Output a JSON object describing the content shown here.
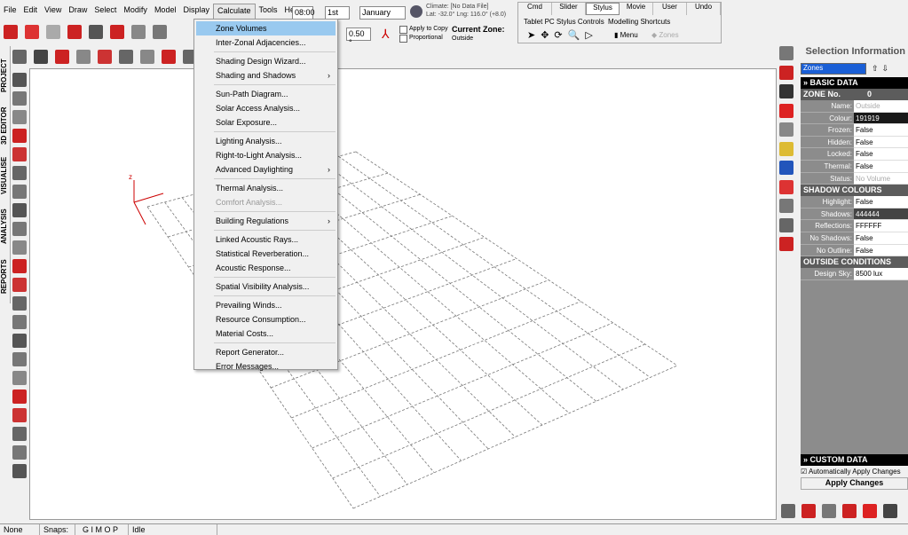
{
  "menubar": [
    "File",
    "Edit",
    "View",
    "Draw",
    "Select",
    "Modify",
    "Model",
    "Display",
    "Calculate",
    "Tools",
    "Help"
  ],
  "toolbar": {
    "time": "08:00",
    "day": "1st",
    "month": "January",
    "climate": "Climate: [No Data File]",
    "latlng": "Lat: -32.0°   Lng: 116.0° (+8.0)",
    "angle": "0.50 °",
    "apply_to_copy": "Apply to Copy",
    "proportional": "Proportional",
    "current_zone_label": "Current Zone:",
    "current_zone": "Outside"
  },
  "tabs": [
    "Cmd",
    "Slider",
    "Stylus",
    "Movie",
    "User",
    "Undo"
  ],
  "stylus": {
    "tablet_label": "Tablet PC Stylus Controls",
    "shortcuts_label": "Modelling Shortcuts",
    "menu": "Menu",
    "zones": "Zones"
  },
  "side_tabs": [
    "PROJECT",
    "3D EDITOR",
    "VISUALISE",
    "ANALYSIS",
    "REPORTS"
  ],
  "calc_menu": [
    {
      "label": "Zone Volumes",
      "state": "highlighted"
    },
    {
      "label": "Inter-Zonal Adjacencies..."
    },
    {
      "sep": true
    },
    {
      "label": "Shading Design Wizard..."
    },
    {
      "label": "Shading and Shadows",
      "sub": true
    },
    {
      "sep": true
    },
    {
      "label": "Sun-Path Diagram..."
    },
    {
      "label": "Solar Access Analysis..."
    },
    {
      "label": "Solar Exposure..."
    },
    {
      "sep": true
    },
    {
      "label": "Lighting Analysis..."
    },
    {
      "label": "Right-to-Light Analysis..."
    },
    {
      "label": "Advanced Daylighting",
      "sub": true
    },
    {
      "sep": true
    },
    {
      "label": "Thermal Analysis..."
    },
    {
      "label": "Comfort Analysis...",
      "state": "disabled"
    },
    {
      "sep": true
    },
    {
      "label": "Building Regulations",
      "sub": true
    },
    {
      "sep": true
    },
    {
      "label": "Linked Acoustic Rays..."
    },
    {
      "label": "Statistical Reverberation..."
    },
    {
      "label": "Acoustic Response..."
    },
    {
      "sep": true
    },
    {
      "label": "Spatial Visibility Analysis..."
    },
    {
      "sep": true
    },
    {
      "label": "Prevailing Winds..."
    },
    {
      "label": "Resource Consumption..."
    },
    {
      "label": "Material Costs..."
    },
    {
      "sep": true
    },
    {
      "label": "Report Generator..."
    },
    {
      "label": "Error Messages..."
    }
  ],
  "panel": {
    "title": "Selection Information",
    "selector": "Zones",
    "basic_data": "BASIC DATA",
    "zone_no_label": "ZONE No.",
    "zone_no": "0",
    "basic": [
      [
        "Name:",
        "Outside"
      ],
      [
        "Colour:",
        "191919"
      ],
      [
        "Frozen:",
        "False"
      ],
      [
        "Hidden:",
        "False"
      ],
      [
        "Locked:",
        "False"
      ],
      [
        "Thermal:",
        "False"
      ],
      [
        "Status:",
        "No Volume"
      ]
    ],
    "shadow_header": "SHADOW COLOURS",
    "shadow": [
      [
        "Highlight:",
        "False"
      ],
      [
        "Shadows:",
        "444444"
      ],
      [
        "Reflections:",
        "FFFFFF"
      ],
      [
        "No Shadows:",
        "False"
      ],
      [
        "No Outline:",
        "False"
      ]
    ],
    "outside_header": "OUTSIDE CONDITIONS",
    "outside": [
      [
        "Design Sky:",
        "8500 lux"
      ]
    ],
    "custom_data": "CUSTOM DATA",
    "auto_apply": "Automatically Apply Changes",
    "apply": "Apply Changes"
  },
  "status": {
    "sel": "None",
    "snaps": "Snaps:",
    "snap_flags": "G I    M O P",
    "state": "Idle"
  },
  "axis_label": "z"
}
